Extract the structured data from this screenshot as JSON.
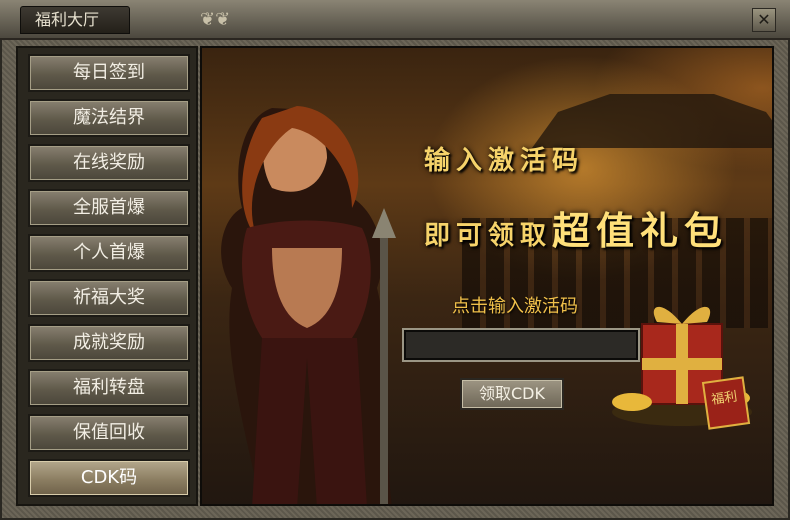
{
  "window": {
    "title": "福利大厅"
  },
  "sidebar": {
    "items": [
      {
        "label": "每日签到",
        "active": false
      },
      {
        "label": "魔法结界",
        "active": false
      },
      {
        "label": "在线奖励",
        "active": false
      },
      {
        "label": "全服首爆",
        "active": false
      },
      {
        "label": "个人首爆",
        "active": false
      },
      {
        "label": "祈福大奖",
        "active": false
      },
      {
        "label": "成就奖励",
        "active": false
      },
      {
        "label": "福利转盘",
        "active": false
      },
      {
        "label": "保值回收",
        "active": false
      },
      {
        "label": "CDK码",
        "active": true
      }
    ]
  },
  "content": {
    "slogan_line1": "输入激活码",
    "slogan_line2_prefix": "即可领取",
    "slogan_line2_highlight": "超值礼包",
    "prompt": "点击输入激活码",
    "cdk_input": {
      "value": "",
      "placeholder": ""
    },
    "claim_button": "领取CDK",
    "gift_tag": "福利"
  },
  "colors": {
    "accent_gold": "#f6d36a",
    "frame_stone": "#6c6658",
    "button_face": "#6d6656"
  }
}
